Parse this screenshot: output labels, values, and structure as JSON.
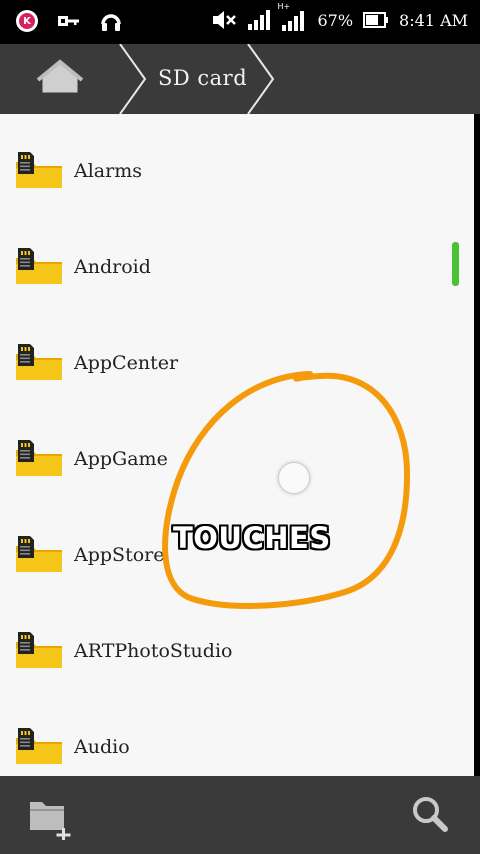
{
  "status_bar": {
    "battery_percent": "67%",
    "time": "8:41 AM",
    "network_type": "H+",
    "k_app_letter": "K",
    "icons": [
      "k-app-icon",
      "key-icon",
      "headset-icon",
      "mute-icon",
      "signal-icon",
      "data-signal-icon",
      "battery-icon"
    ]
  },
  "title_bar": {
    "home_icon": "home-icon",
    "breadcrumb": "SD card"
  },
  "folders": [
    {
      "name": "Alarms"
    },
    {
      "name": "Android"
    },
    {
      "name": "AppCenter"
    },
    {
      "name": "AppGame"
    },
    {
      "name": "AppStore"
    },
    {
      "name": "ARTPhotoStudio"
    },
    {
      "name": "Audio"
    }
  ],
  "annotation": {
    "label": "TOUCHES",
    "circle_color": "#f59b0b"
  },
  "bottom_bar": {
    "new_folder_icon": "new-folder-icon",
    "search_icon": "search-icon"
  },
  "colors": {
    "bar_bg": "#3a3a3a",
    "list_bg": "#f7f7f7",
    "folder_yellow": "#f5c518",
    "scroll_green": "#4bc236"
  }
}
